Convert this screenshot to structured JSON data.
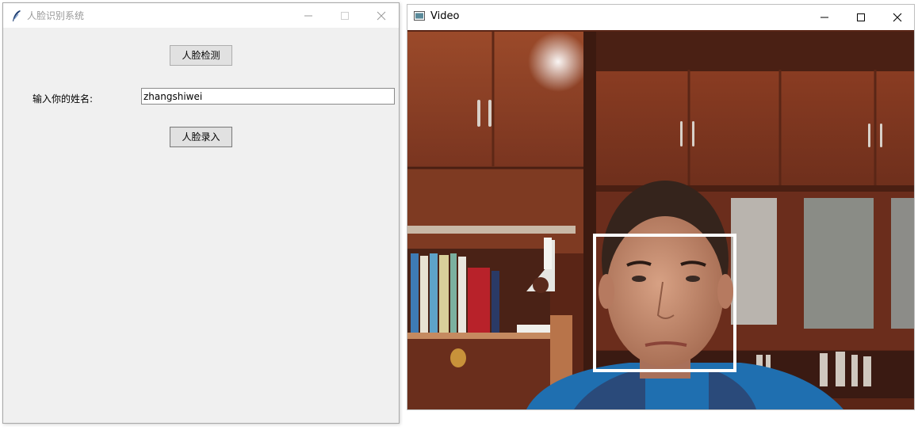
{
  "tk_window": {
    "title": "人脸识别系统",
    "detect_button": "人脸检测",
    "name_label": "输入你的姓名:",
    "name_value": "zhangshiwei",
    "enroll_button": "人脸录入"
  },
  "video_window": {
    "title": "Video",
    "face_box_color": "#ffffff"
  },
  "icons": {
    "app_icon": "feather-icon",
    "video_icon": "window-app-icon",
    "minimize": "minimize-icon",
    "maximize": "maximize-icon",
    "close": "close-icon"
  }
}
